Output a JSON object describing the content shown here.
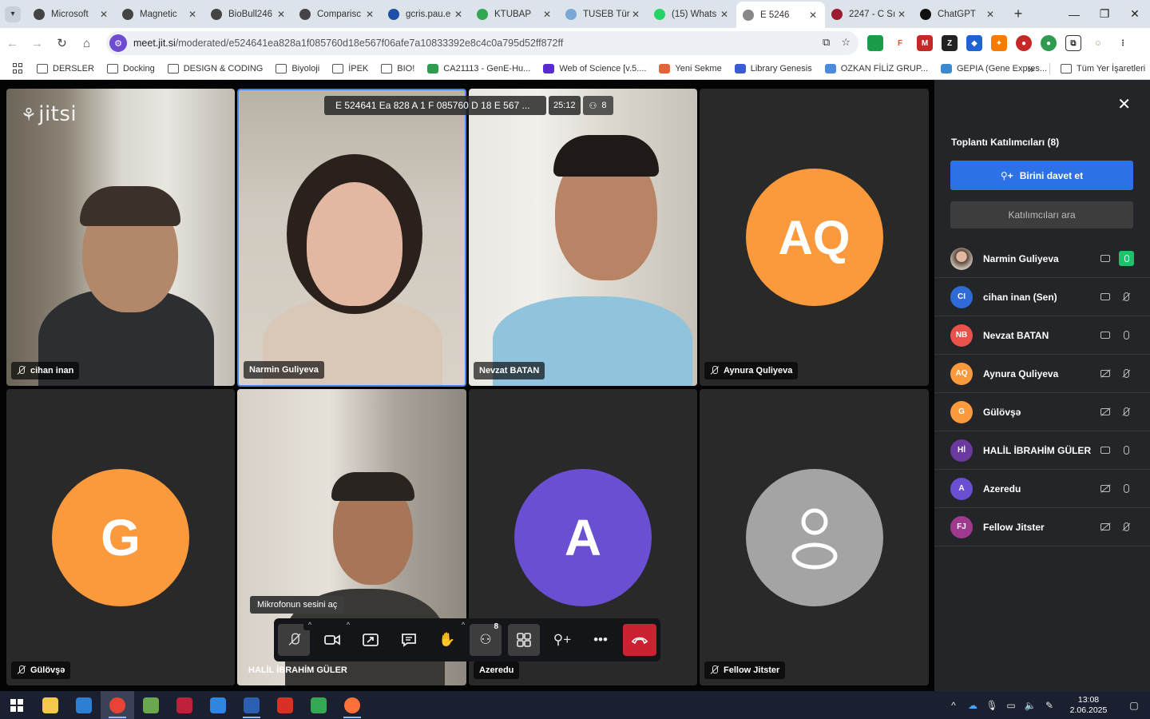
{
  "browser": {
    "tabs": [
      {
        "label": "Microsoft",
        "color": "#444444"
      },
      {
        "label": "Magnetic",
        "color": "#444444"
      },
      {
        "label": "BioBull246",
        "color": "#444444"
      },
      {
        "label": "Comparisc",
        "color": "#444444"
      },
      {
        "label": "gcris.pau.e",
        "color": "#1e4fa8"
      },
      {
        "label": "KTUBAP",
        "color": "#2fa84f"
      },
      {
        "label": "TÜSEB Türl",
        "color": "#7aa7d6"
      },
      {
        "label": "(15) Whats",
        "color": "#25d366"
      },
      {
        "label": "E 5246",
        "color": "#888888"
      },
      {
        "label": "2247 - C Sı",
        "color": "#9b1c2e"
      },
      {
        "label": "ChatGPT",
        "color": "#111111"
      }
    ],
    "active_tab_index": 8,
    "new_tab": "+",
    "window_controls": {
      "minimize": "—",
      "restore": "❐",
      "close": "✕"
    },
    "url_host": "meet.jit.si",
    "url_path": "/moderated/e524641ea828a1f085760d18e567f06afe7a10833392e8c4c0a795d52ff872ff",
    "bookmarks": [
      {
        "label": "DERSLER",
        "type": "folder"
      },
      {
        "label": "Docking",
        "type": "folder"
      },
      {
        "label": "DESIGN & CODING",
        "type": "folder"
      },
      {
        "label": "Biyoloji",
        "type": "folder"
      },
      {
        "label": "İPEK",
        "type": "folder"
      },
      {
        "label": "BIO!",
        "type": "folder"
      },
      {
        "label": "CA21113 - GenE-Hu...",
        "type": "site",
        "color": "#2e9b4f"
      },
      {
        "label": "Web of Science [v.5....",
        "type": "site",
        "color": "#5a2bd1"
      },
      {
        "label": "Yeni Sekme",
        "type": "site",
        "color": "#e0663a"
      },
      {
        "label": "Library Genesis",
        "type": "site",
        "color": "#3a5bd1"
      },
      {
        "label": "OZKAN FİLİZ GRUP...",
        "type": "site",
        "color": "#4a8be0"
      },
      {
        "label": "GEPIA (Gene Expres...",
        "type": "site",
        "color": "#3a8ad1"
      }
    ],
    "bookmarks_more": "»",
    "all_bookmarks": "Tüm Yer İşaretleri"
  },
  "meeting": {
    "logo": "jitsi",
    "subject": "E 524641 Ea 828 A 1 F 085760 D 18 E 567 ...",
    "timer": "25:12",
    "participant_count": "8",
    "tiles": [
      {
        "name": "cihan inan",
        "muted": true,
        "video": true
      },
      {
        "name": "Narmin Guliyeva",
        "muted": false,
        "video": true,
        "active": true
      },
      {
        "name": "Nevzat BATAN",
        "muted": false,
        "video": true
      },
      {
        "name": "Aynura Quliyeva",
        "muted": true,
        "video": false,
        "initials": "AQ",
        "color": "#fb9a3c"
      },
      {
        "name": "Gülövşə",
        "muted": true,
        "video": false,
        "initials": "G",
        "color": "#fb9a3c"
      },
      {
        "name": "HALİL İBRAHİM GÜLER",
        "muted": false,
        "video": true
      },
      {
        "name": "Azeredu",
        "muted": false,
        "video": false,
        "initials": "A",
        "color": "#6a4fd3"
      },
      {
        "name": "Fellow Jitster",
        "muted": true,
        "video": false,
        "initials": "",
        "color": "#a4a4a4"
      }
    ],
    "tooltip": "Mikrofonun sesini aç",
    "toolbar_badge": "8"
  },
  "panel": {
    "title": "Toplantı Katılımcıları (8)",
    "invite_label": "Birini davet et",
    "search_placeholder": "Katılımcıları ara",
    "participants": [
      {
        "name": "Narmin Guliyeva",
        "initials": "",
        "color": "#b8a99a",
        "cam": "on",
        "mic": "active"
      },
      {
        "name": "cihan inan (Sen)",
        "initials": "CI",
        "color": "#2f6bd6",
        "cam": "on",
        "mic": "off"
      },
      {
        "name": "Nevzat BATAN",
        "initials": "NB",
        "color": "#e8524a",
        "cam": "on",
        "mic": "on"
      },
      {
        "name": "Aynura Quliyeva",
        "initials": "AQ",
        "color": "#fb9a3c",
        "cam": "off",
        "mic": "off"
      },
      {
        "name": "Gülövşə",
        "initials": "G",
        "color": "#fb9a3c",
        "cam": "off",
        "mic": "off"
      },
      {
        "name": "HALİL İBRAHİM GÜLER",
        "initials": "Hİ",
        "color": "#6b3a9e",
        "cam": "on",
        "mic": "on"
      },
      {
        "name": "Azeredu",
        "initials": "A",
        "color": "#6a4fd3",
        "cam": "off",
        "mic": "on"
      },
      {
        "name": "Fellow Jitster",
        "initials": "FJ",
        "color": "#a03a8e",
        "cam": "off",
        "mic": "off"
      }
    ]
  },
  "taskbar": {
    "apps": [
      {
        "name": "file-explorer",
        "color": "#f2c94c"
      },
      {
        "name": "discovery-studio",
        "color": "#2d7fd3"
      },
      {
        "name": "chrome",
        "color": "#e84335",
        "running": true,
        "focused": true
      },
      {
        "name": "excel-like",
        "color": "#6aa84f"
      },
      {
        "name": "mendeley",
        "color": "#c0213a"
      },
      {
        "name": "blue-app",
        "color": "#2e86de"
      },
      {
        "name": "word",
        "color": "#2b5fb4",
        "running": true
      },
      {
        "name": "pdf-app",
        "color": "#d93025"
      },
      {
        "name": "drive",
        "color": "#34a853"
      },
      {
        "name": "firefox",
        "color": "#ff7139",
        "running": true
      }
    ],
    "time": "13:08",
    "date": "2.06.2025"
  }
}
